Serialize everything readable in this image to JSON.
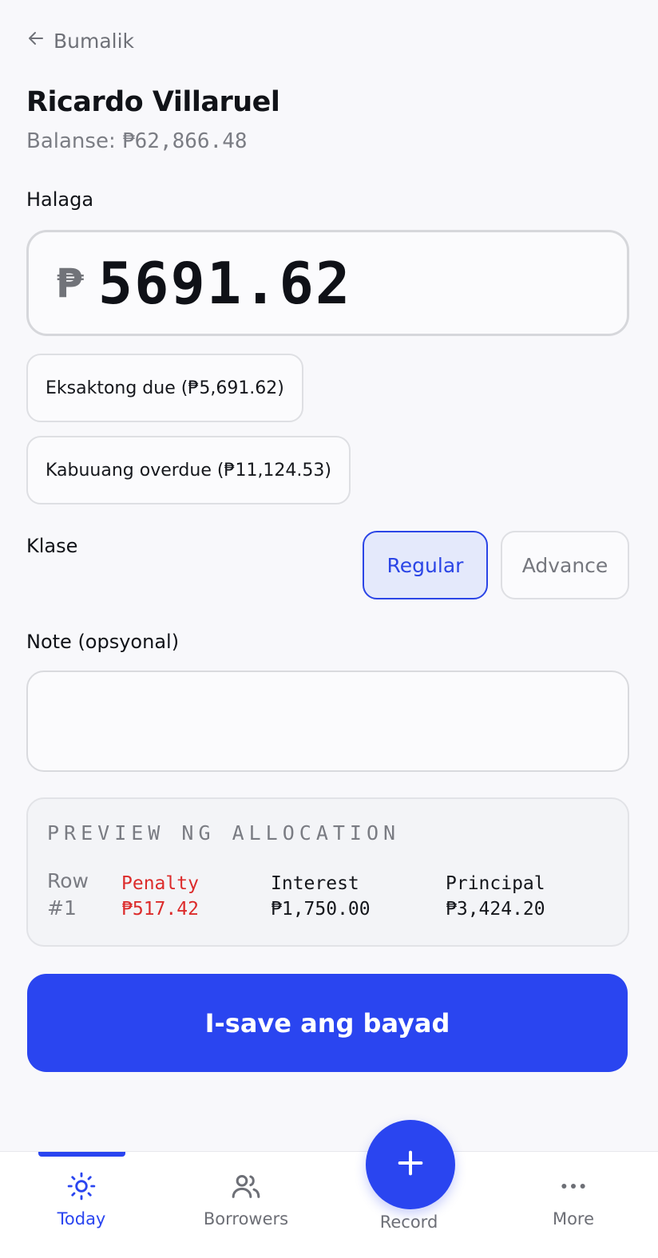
{
  "header": {
    "back_label": "Bumalik",
    "borrower_name": "Ricardo Villaruel",
    "balance_label": "Balanse:",
    "balance_value": "₱62,866.48"
  },
  "amount": {
    "label": "Halaga",
    "currency_symbol": "₱",
    "value": "5691.62"
  },
  "quick_amounts": [
    {
      "label": "Eksaktong due (₱5,691.62)"
    },
    {
      "label": "Kabuuang overdue (₱11,124.53)"
    }
  ],
  "payment_type": {
    "label": "Klase",
    "options": [
      "Regular",
      "Advance"
    ],
    "selected": "Regular"
  },
  "note": {
    "label": "Note (opsyonal)",
    "value": ""
  },
  "preview": {
    "title": "PREVIEW NG ALLOCATION",
    "row_label": "Row #1",
    "penalty_label": "Penalty",
    "penalty_value": "₱517.42",
    "interest_label": "Interest",
    "interest_value": "₱1,750.00",
    "principal_label": "Principal",
    "principal_value": "₱3,424.20"
  },
  "save_label": "I-save ang bayad",
  "nav": {
    "today": "Today",
    "borrowers": "Borrowers",
    "record": "Record",
    "more": "More",
    "active": "Today"
  },
  "colors": {
    "accent": "#2a45f0",
    "penalty": "#dc2b2b",
    "background": "#f8f8fb"
  }
}
